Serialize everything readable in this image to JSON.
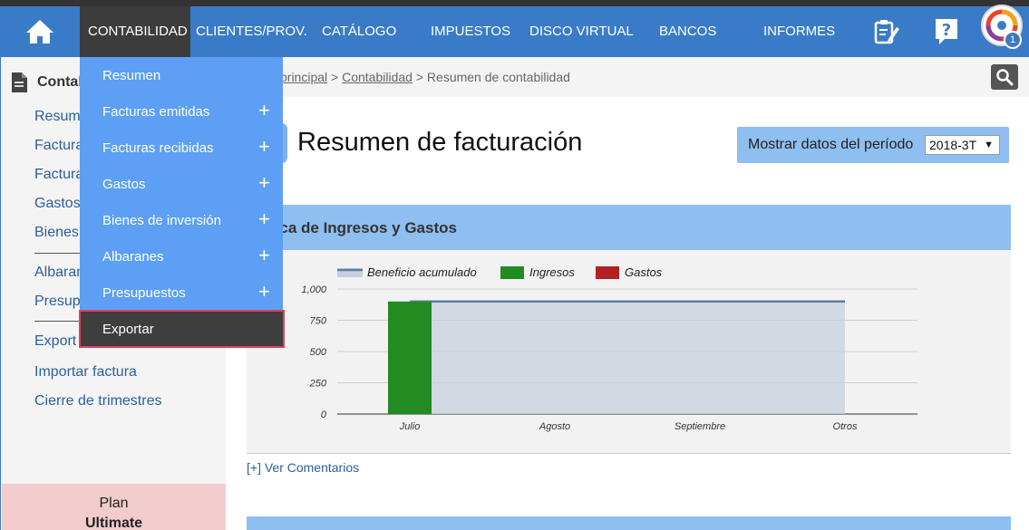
{
  "nav": {
    "items": [
      {
        "key": "contabilidad",
        "label": "CONTABILIDAD"
      },
      {
        "key": "clientes",
        "label": "CLIENTES/PROV."
      },
      {
        "key": "catalogo",
        "label": "CATÁLOGO"
      },
      {
        "key": "impuestos",
        "label": "IMPUESTOS"
      },
      {
        "key": "disco",
        "label": "DISCO VIRTUAL"
      },
      {
        "key": "bancos",
        "label": "BANCOS"
      },
      {
        "key": "informes",
        "label": "INFORMES"
      }
    ],
    "notification_count": "1",
    "colors": {
      "bar": "#3a7bc8",
      "active": "#3c3c3c"
    }
  },
  "sidebar": {
    "heading": "Contabi",
    "links": [
      "Resum",
      "Factura",
      "Factura",
      "Gastos",
      "Bienes",
      "Albaran",
      "Presup",
      "Export",
      "Importar factura",
      "Cierre de trimestres"
    ],
    "plan_label": "Plan",
    "plan_name": "Ultimate"
  },
  "breadcrumb": {
    "home": "principal",
    "section": "Contabilidad",
    "current": "Resumen de contabilidad",
    "sep": ">"
  },
  "page": {
    "title": "Resumen de facturación",
    "period_label": "Mostrar datos del período",
    "period_value": "2018-3T",
    "comments_link": "[+] Ver Comentarios"
  },
  "dropdown": {
    "items": [
      {
        "label": "Resumen",
        "expandable": false
      },
      {
        "label": "Facturas emitidas",
        "expandable": true
      },
      {
        "label": "Facturas recibidas",
        "expandable": true
      },
      {
        "label": "Gastos",
        "expandable": true
      },
      {
        "label": "Bienes de inversión",
        "expandable": true
      },
      {
        "label": "Albaranes",
        "expandable": true
      },
      {
        "label": "Presupuestos",
        "expandable": true
      }
    ],
    "export_label": "Exportar"
  },
  "chart_data": {
    "type": "bar",
    "title": "fica de Ingresos y Gastos",
    "categories": [
      "Julio",
      "Agosto",
      "Septiembre",
      "Otros"
    ],
    "series": [
      {
        "name": "Ingresos",
        "type": "bar",
        "color": "#228b22",
        "values": [
          900,
          0,
          0,
          0
        ]
      },
      {
        "name": "Gastos",
        "type": "bar",
        "color": "#b22222",
        "values": [
          0,
          0,
          0,
          0
        ]
      },
      {
        "name": "Beneficio acumulado",
        "type": "area",
        "color": "#5b7fa8",
        "values": [
          900,
          900,
          900,
          900
        ]
      }
    ],
    "yticks": [
      0,
      250,
      500,
      750,
      1000
    ],
    "ytick_labels": [
      "0",
      "250",
      "500",
      "750",
      "1,000"
    ],
    "ylim": [
      0,
      1000
    ],
    "grid": true,
    "legend": "top"
  }
}
